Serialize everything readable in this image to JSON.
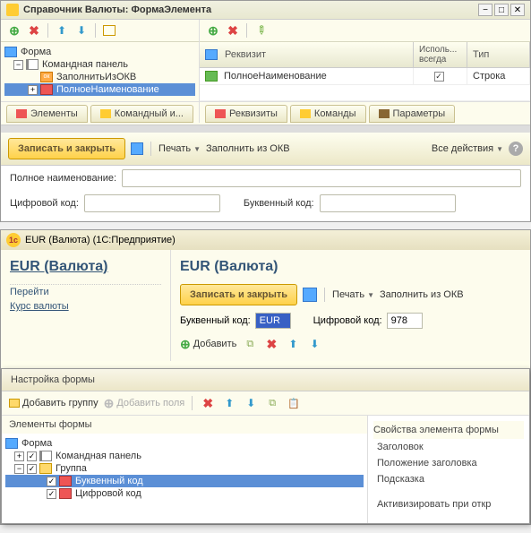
{
  "win1": {
    "title": "Справочник Валюты: ФормаЭлемента",
    "tree": {
      "root": "Форма",
      "panel": "Командная панель",
      "btn1": "ЗаполнитьИзОКВ",
      "field1": "ПолноеНаименование"
    },
    "gridHead": {
      "c1": "Реквизит",
      "c2": "Исполь...\nвсегда",
      "c3": "Тип"
    },
    "gridRow": {
      "c1": "ПолноеНаименование",
      "c3": "Строка"
    },
    "tabsLeft": {
      "t1": "Элементы",
      "t2": "Командный и..."
    },
    "tabsRight": {
      "t1": "Реквизиты",
      "t2": "Команды",
      "t3": "Параметры"
    },
    "preview": {
      "save": "Записать и закрыть",
      "print": "Печать",
      "fill": "Заполнить из ОКВ",
      "all": "Все действия",
      "lbl1": "Полное наименование:",
      "lbl2": "Цифровой код:",
      "lbl3": "Буквенный код:"
    }
  },
  "win2": {
    "title": "EUR (Валюта)  (1С:Предприятие)",
    "sideTitle": "EUR (Валюта)",
    "sideSec": "Перейти",
    "sideLink": "Курс валюты",
    "mainTitle": "EUR (Валюта)",
    "save": "Записать и закрыть",
    "print": "Печать",
    "fill": "Заполнить из ОКВ",
    "lblLetter": "Буквенный код:",
    "valLetter": "EUR",
    "lblDigit": "Цифровой код:",
    "valDigit": "978",
    "add": "Добавить"
  },
  "modal": {
    "title": "Настройка формы",
    "addGroup": "Добавить группу",
    "addFields": "Добавить поля",
    "leftTitle": "Элементы формы",
    "rightTitle": "Свойства элемента формы",
    "tree": {
      "root": "Форма",
      "panel": "Командная панель",
      "group": "Группа",
      "f1": "Буквенный код",
      "f2": "Цифровой код"
    },
    "props": {
      "p1": "Заголовок",
      "p2": "Положение заголовка",
      "p3": "Подсказка",
      "p4": "Активизировать при откр"
    }
  }
}
